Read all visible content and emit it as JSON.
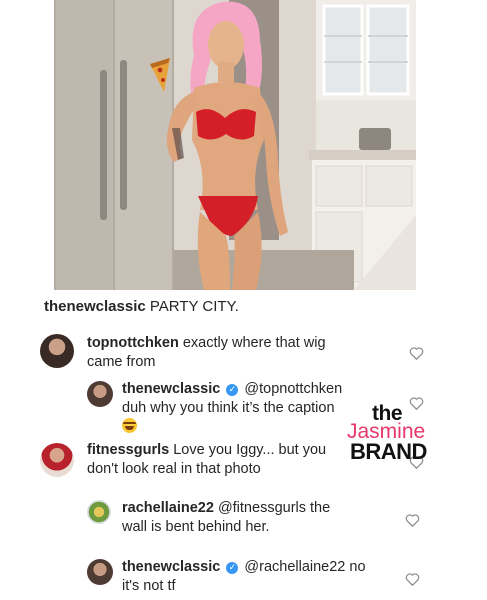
{
  "post": {
    "image_alt": "",
    "caption": {
      "username": "thenewclassic",
      "text": "PARTY CITY."
    }
  },
  "comments": [
    {
      "username": "topnottchken",
      "mention": "",
      "text": "exactly where that wig",
      "text2": "came from",
      "verified": false
    },
    {
      "username": "thenewclassic",
      "mention": "@topnottchken",
      "text": "duh why you think it’s the caption",
      "emoji": "laughing-face",
      "verified": true
    },
    {
      "username": "fitnessgurls",
      "mention": "",
      "text": "Love you Iggy... but you",
      "text2": "don't look real in that photo",
      "verified": false
    },
    {
      "username": "rachellaine22",
      "mention": "@fitnessgurls",
      "text": "the",
      "text2": "wall is bent behind her.",
      "verified": false
    },
    {
      "username": "thenewclassic",
      "mention": "@rachellaine22",
      "text": "no",
      "text2": "it's not tf",
      "verified": true
    }
  ],
  "watermark": {
    "line1": "the",
    "line2": "Jasmine",
    "line3": "BRAND"
  },
  "colors": {
    "verified_badge": "#3897f0",
    "watermark_pink": "#e8376c",
    "text": "#262626",
    "heart_outline": "#8e8e8e"
  },
  "icons": {
    "like": "heart-outline-icon",
    "verified": "verified-badge-icon"
  }
}
